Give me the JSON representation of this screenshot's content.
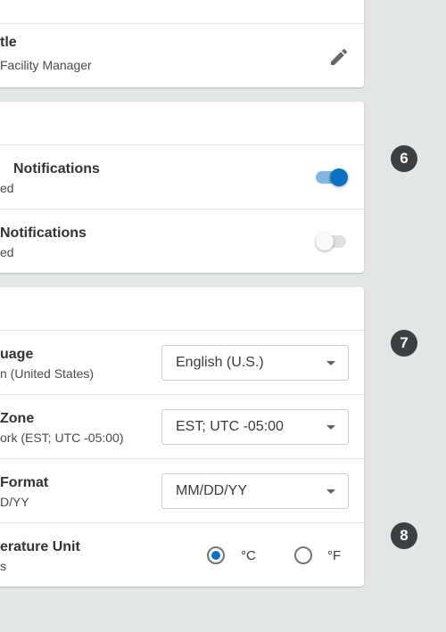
{
  "job_title_row": {
    "title": "tle",
    "value": "Facility Manager",
    "edit_icon": "pencil-icon"
  },
  "notifications": {
    "rows": [
      {
        "title": "Notifications",
        "sub": "ed",
        "toggle": true
      },
      {
        "title": "Notifications",
        "sub": "ed",
        "toggle": false
      }
    ]
  },
  "preferences": {
    "language": {
      "title": "uage",
      "sub": "n (United States)",
      "value": "English (U.S.)"
    },
    "timezone": {
      "title": "Zone",
      "sub": "ork (EST; UTC -05:00)",
      "value": "EST; UTC -05:00"
    },
    "date_format": {
      "title": "Format",
      "sub": "D/YY",
      "value": "MM/DD/YY"
    },
    "temperature": {
      "title": "erature Unit",
      "sub": "s",
      "options": [
        "°C",
        "°F"
      ],
      "selected": "°C"
    }
  },
  "badges": [
    "6",
    "7",
    "8"
  ],
  "colors": {
    "accent": "#0a72c2",
    "background": "#e3e6e6",
    "badge": "#3c4043"
  }
}
